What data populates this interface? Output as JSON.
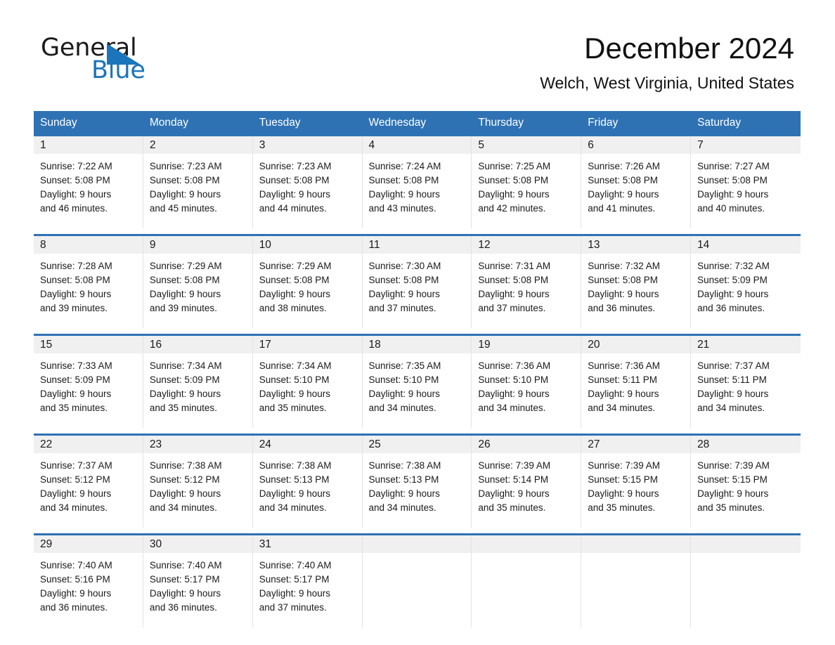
{
  "brand": {
    "name_part1": "General",
    "name_part2": "Blue",
    "accent_color": "#1b75bb"
  },
  "header": {
    "month_title": "December 2024",
    "location": "Welch, West Virginia, United States"
  },
  "theme": {
    "header_bg": "#2e72b4",
    "row_divider": "#2e72b4",
    "daynum_band": "#f0f0f0"
  },
  "calendar": {
    "weekday_headers": [
      "Sunday",
      "Monday",
      "Tuesday",
      "Wednesday",
      "Thursday",
      "Friday",
      "Saturday"
    ],
    "weeks": [
      [
        {
          "day": "1",
          "sunrise": "Sunrise: 7:22 AM",
          "sunset": "Sunset: 5:08 PM",
          "daylight1": "Daylight: 9 hours",
          "daylight2": "and 46 minutes."
        },
        {
          "day": "2",
          "sunrise": "Sunrise: 7:23 AM",
          "sunset": "Sunset: 5:08 PM",
          "daylight1": "Daylight: 9 hours",
          "daylight2": "and 45 minutes."
        },
        {
          "day": "3",
          "sunrise": "Sunrise: 7:23 AM",
          "sunset": "Sunset: 5:08 PM",
          "daylight1": "Daylight: 9 hours",
          "daylight2": "and 44 minutes."
        },
        {
          "day": "4",
          "sunrise": "Sunrise: 7:24 AM",
          "sunset": "Sunset: 5:08 PM",
          "daylight1": "Daylight: 9 hours",
          "daylight2": "and 43 minutes."
        },
        {
          "day": "5",
          "sunrise": "Sunrise: 7:25 AM",
          "sunset": "Sunset: 5:08 PM",
          "daylight1": "Daylight: 9 hours",
          "daylight2": "and 42 minutes."
        },
        {
          "day": "6",
          "sunrise": "Sunrise: 7:26 AM",
          "sunset": "Sunset: 5:08 PM",
          "daylight1": "Daylight: 9 hours",
          "daylight2": "and 41 minutes."
        },
        {
          "day": "7",
          "sunrise": "Sunrise: 7:27 AM",
          "sunset": "Sunset: 5:08 PM",
          "daylight1": "Daylight: 9 hours",
          "daylight2": "and 40 minutes."
        }
      ],
      [
        {
          "day": "8",
          "sunrise": "Sunrise: 7:28 AM",
          "sunset": "Sunset: 5:08 PM",
          "daylight1": "Daylight: 9 hours",
          "daylight2": "and 39 minutes."
        },
        {
          "day": "9",
          "sunrise": "Sunrise: 7:29 AM",
          "sunset": "Sunset: 5:08 PM",
          "daylight1": "Daylight: 9 hours",
          "daylight2": "and 39 minutes."
        },
        {
          "day": "10",
          "sunrise": "Sunrise: 7:29 AM",
          "sunset": "Sunset: 5:08 PM",
          "daylight1": "Daylight: 9 hours",
          "daylight2": "and 38 minutes."
        },
        {
          "day": "11",
          "sunrise": "Sunrise: 7:30 AM",
          "sunset": "Sunset: 5:08 PM",
          "daylight1": "Daylight: 9 hours",
          "daylight2": "and 37 minutes."
        },
        {
          "day": "12",
          "sunrise": "Sunrise: 7:31 AM",
          "sunset": "Sunset: 5:08 PM",
          "daylight1": "Daylight: 9 hours",
          "daylight2": "and 37 minutes."
        },
        {
          "day": "13",
          "sunrise": "Sunrise: 7:32 AM",
          "sunset": "Sunset: 5:08 PM",
          "daylight1": "Daylight: 9 hours",
          "daylight2": "and 36 minutes."
        },
        {
          "day": "14",
          "sunrise": "Sunrise: 7:32 AM",
          "sunset": "Sunset: 5:09 PM",
          "daylight1": "Daylight: 9 hours",
          "daylight2": "and 36 minutes."
        }
      ],
      [
        {
          "day": "15",
          "sunrise": "Sunrise: 7:33 AM",
          "sunset": "Sunset: 5:09 PM",
          "daylight1": "Daylight: 9 hours",
          "daylight2": "and 35 minutes."
        },
        {
          "day": "16",
          "sunrise": "Sunrise: 7:34 AM",
          "sunset": "Sunset: 5:09 PM",
          "daylight1": "Daylight: 9 hours",
          "daylight2": "and 35 minutes."
        },
        {
          "day": "17",
          "sunrise": "Sunrise: 7:34 AM",
          "sunset": "Sunset: 5:10 PM",
          "daylight1": "Daylight: 9 hours",
          "daylight2": "and 35 minutes."
        },
        {
          "day": "18",
          "sunrise": "Sunrise: 7:35 AM",
          "sunset": "Sunset: 5:10 PM",
          "daylight1": "Daylight: 9 hours",
          "daylight2": "and 34 minutes."
        },
        {
          "day": "19",
          "sunrise": "Sunrise: 7:36 AM",
          "sunset": "Sunset: 5:10 PM",
          "daylight1": "Daylight: 9 hours",
          "daylight2": "and 34 minutes."
        },
        {
          "day": "20",
          "sunrise": "Sunrise: 7:36 AM",
          "sunset": "Sunset: 5:11 PM",
          "daylight1": "Daylight: 9 hours",
          "daylight2": "and 34 minutes."
        },
        {
          "day": "21",
          "sunrise": "Sunrise: 7:37 AM",
          "sunset": "Sunset: 5:11 PM",
          "daylight1": "Daylight: 9 hours",
          "daylight2": "and 34 minutes."
        }
      ],
      [
        {
          "day": "22",
          "sunrise": "Sunrise: 7:37 AM",
          "sunset": "Sunset: 5:12 PM",
          "daylight1": "Daylight: 9 hours",
          "daylight2": "and 34 minutes."
        },
        {
          "day": "23",
          "sunrise": "Sunrise: 7:38 AM",
          "sunset": "Sunset: 5:12 PM",
          "daylight1": "Daylight: 9 hours",
          "daylight2": "and 34 minutes."
        },
        {
          "day": "24",
          "sunrise": "Sunrise: 7:38 AM",
          "sunset": "Sunset: 5:13 PM",
          "daylight1": "Daylight: 9 hours",
          "daylight2": "and 34 minutes."
        },
        {
          "day": "25",
          "sunrise": "Sunrise: 7:38 AM",
          "sunset": "Sunset: 5:13 PM",
          "daylight1": "Daylight: 9 hours",
          "daylight2": "and 34 minutes."
        },
        {
          "day": "26",
          "sunrise": "Sunrise: 7:39 AM",
          "sunset": "Sunset: 5:14 PM",
          "daylight1": "Daylight: 9 hours",
          "daylight2": "and 35 minutes."
        },
        {
          "day": "27",
          "sunrise": "Sunrise: 7:39 AM",
          "sunset": "Sunset: 5:15 PM",
          "daylight1": "Daylight: 9 hours",
          "daylight2": "and 35 minutes."
        },
        {
          "day": "28",
          "sunrise": "Sunrise: 7:39 AM",
          "sunset": "Sunset: 5:15 PM",
          "daylight1": "Daylight: 9 hours",
          "daylight2": "and 35 minutes."
        }
      ],
      [
        {
          "day": "29",
          "sunrise": "Sunrise: 7:40 AM",
          "sunset": "Sunset: 5:16 PM",
          "daylight1": "Daylight: 9 hours",
          "daylight2": "and 36 minutes."
        },
        {
          "day": "30",
          "sunrise": "Sunrise: 7:40 AM",
          "sunset": "Sunset: 5:17 PM",
          "daylight1": "Daylight: 9 hours",
          "daylight2": "and 36 minutes."
        },
        {
          "day": "31",
          "sunrise": "Sunrise: 7:40 AM",
          "sunset": "Sunset: 5:17 PM",
          "daylight1": "Daylight: 9 hours",
          "daylight2": "and 37 minutes."
        },
        {
          "day": "",
          "sunrise": "",
          "sunset": "",
          "daylight1": "",
          "daylight2": ""
        },
        {
          "day": "",
          "sunrise": "",
          "sunset": "",
          "daylight1": "",
          "daylight2": ""
        },
        {
          "day": "",
          "sunrise": "",
          "sunset": "",
          "daylight1": "",
          "daylight2": ""
        },
        {
          "day": "",
          "sunrise": "",
          "sunset": "",
          "daylight1": "",
          "daylight2": ""
        }
      ]
    ]
  }
}
